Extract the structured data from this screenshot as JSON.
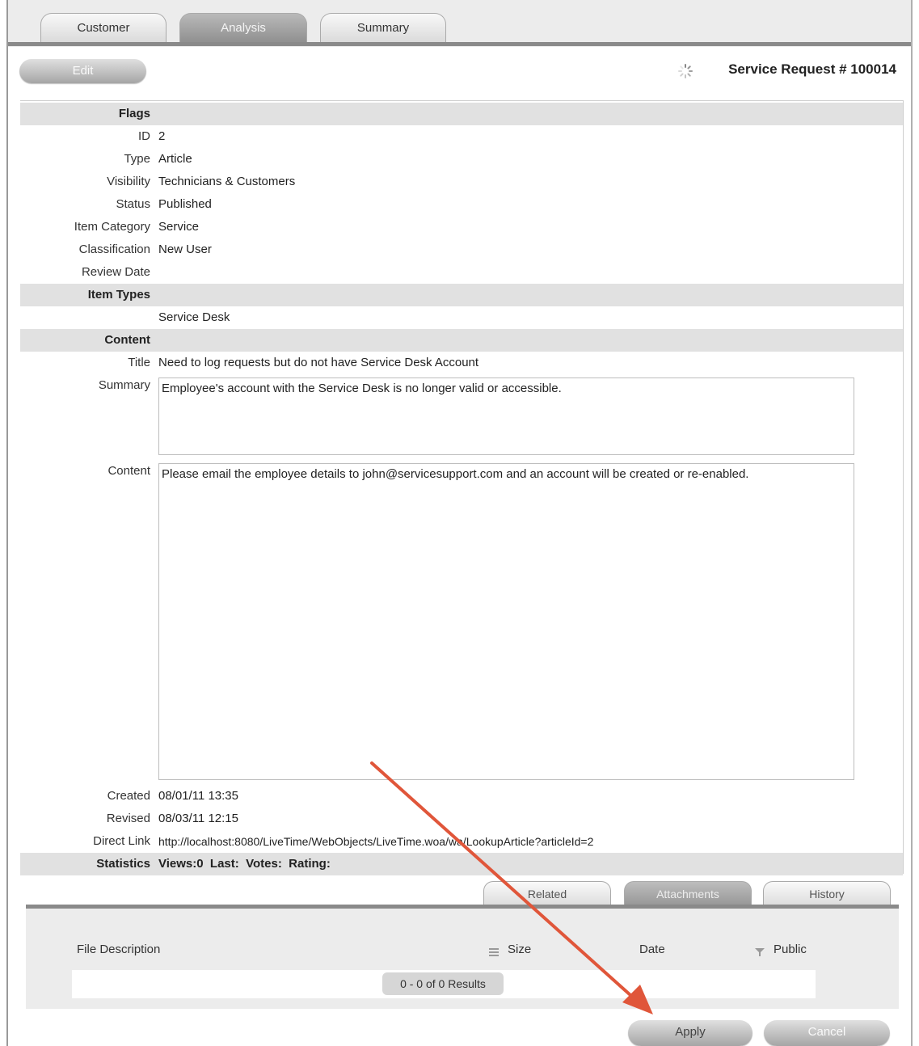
{
  "tabs": [
    "Customer",
    "Analysis",
    "Summary"
  ],
  "active_tab": "Analysis",
  "edit_label": "Edit",
  "request_title": "Service Request # 100014",
  "fields": {
    "flags_label": "Flags",
    "id_label": "ID",
    "id_value": "2",
    "type_label": "Type",
    "type_value": "Article",
    "visibility_label": "Visibility",
    "visibility_value": "Technicians & Customers",
    "status_label": "Status",
    "status_value": "Published",
    "item_category_label": "Item Category",
    "item_category_value": "Service",
    "classification_label": "Classification",
    "classification_value": "New User",
    "review_date_label": "Review Date",
    "review_date_value": "",
    "item_types_label": "Item Types",
    "item_types_value": "Service Desk",
    "content_section_label": "Content",
    "title_label": "Title",
    "title_value": "Need to log requests but do not have Service Desk Account",
    "summary_label": "Summary",
    "summary_value": "Employee's account with the Service Desk is no longer valid or accessible.",
    "content_label": "Content",
    "content_value": "Please email the employee details to john@servicesupport.com and an account will be created or re-enabled.",
    "created_label": "Created",
    "created_value": "08/01/11 13:35",
    "revised_label": "Revised",
    "revised_value": "08/03/11 12:15",
    "direct_link_label": "Direct Link",
    "direct_link_value": "http://localhost:8080/LiveTime/WebObjects/LiveTime.woa/wa/LookupArticle?articleId=2",
    "statistics_label": "Statistics",
    "statistics_value": "Views:0  Last:  Votes:  Rating:"
  },
  "sub_tabs": [
    "Related",
    "Attachments",
    "History"
  ],
  "active_sub_tab": "Attachments",
  "attachments": {
    "columns": [
      "File Description",
      "Size",
      "Date",
      "Public"
    ],
    "results_text": "0 - 0 of 0 Results"
  },
  "buttons": {
    "apply": "Apply",
    "cancel": "Cancel"
  },
  "colors": {
    "annotation_arrow": "#e0563a",
    "section_bg": "#e1e1e1"
  },
  "icons": [
    "spinner-icon",
    "sort-icon",
    "filter-icon"
  ]
}
